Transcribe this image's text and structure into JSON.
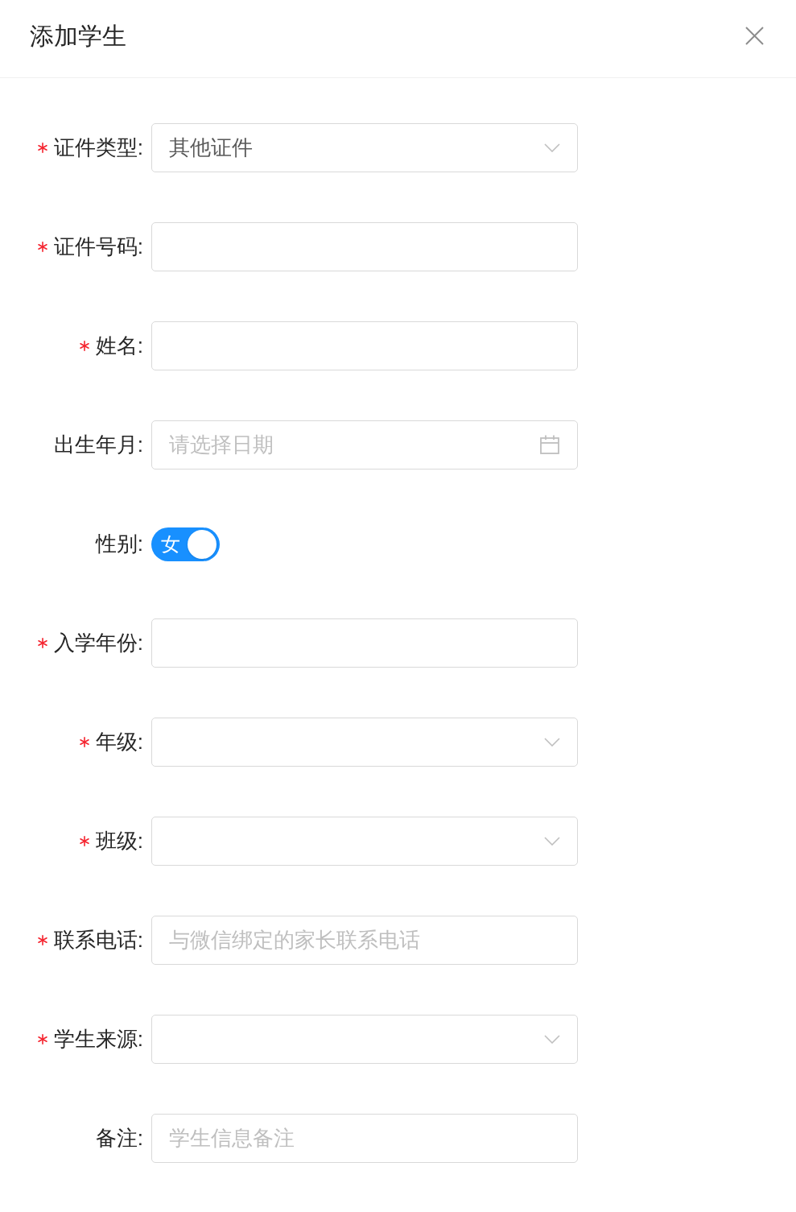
{
  "dialog": {
    "title": "添加学生"
  },
  "fields": [
    {
      "kind": "select",
      "label": "证件类型:",
      "required": true,
      "value": "其他证件"
    },
    {
      "kind": "input",
      "label": "证件号码:",
      "required": true
    },
    {
      "kind": "input",
      "label": "姓名:",
      "required": true
    },
    {
      "kind": "date",
      "label": "出生年月:",
      "required": false,
      "placeholder": "请选择日期"
    },
    {
      "kind": "switch",
      "label": "性别:",
      "required": false,
      "on": true,
      "text": "女"
    },
    {
      "kind": "input",
      "label": "入学年份:",
      "required": true
    },
    {
      "kind": "select",
      "label": "年级:",
      "required": true
    },
    {
      "kind": "select",
      "label": "班级:",
      "required": true
    },
    {
      "kind": "input",
      "label": "联系电话:",
      "required": true,
      "placeholder": "与微信绑定的家长联系电话"
    },
    {
      "kind": "select",
      "label": "学生来源:",
      "required": true
    },
    {
      "kind": "input",
      "label": "备注:",
      "required": false,
      "placeholder": "学生信息备注"
    }
  ]
}
